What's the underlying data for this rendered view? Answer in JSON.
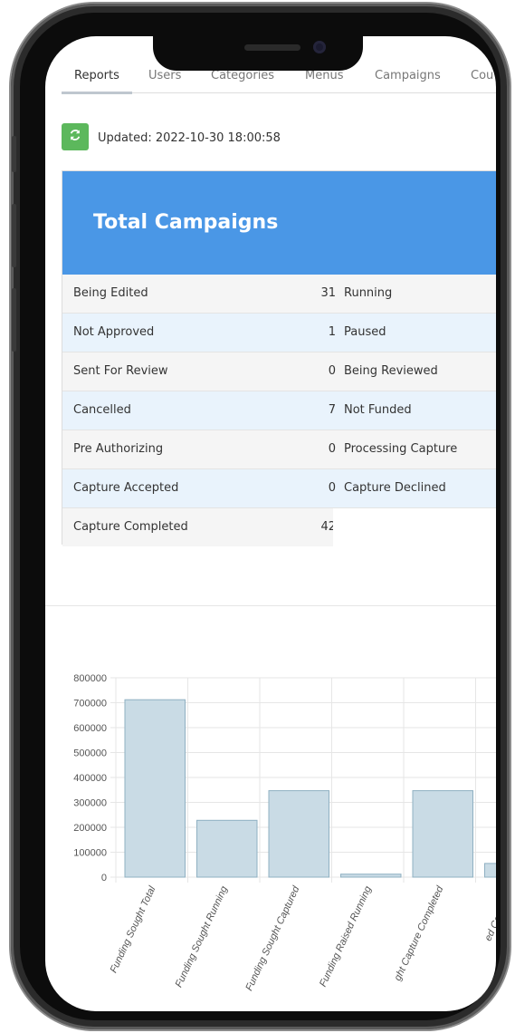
{
  "tabs": [
    "Reports",
    "Users",
    "Categories",
    "Menus",
    "Campaigns",
    "Cou"
  ],
  "updated": "Updated: 2022-10-30 18:00:58",
  "panel_title": "Total Campaigns",
  "rows": [
    {
      "l": "Being Edited",
      "v": "31",
      "r": "Running"
    },
    {
      "l": "Not Approved",
      "v": "1",
      "r": "Paused"
    },
    {
      "l": "Sent For Review",
      "v": "0",
      "r": "Being Reviewed"
    },
    {
      "l": "Cancelled",
      "v": "7",
      "r": "Not Funded"
    },
    {
      "l": "Pre Authorizing",
      "v": "0",
      "r": "Processing Capture"
    },
    {
      "l": "Capture Accepted",
      "v": "0",
      "r": "Capture Declined"
    },
    {
      "l": "Capture Completed",
      "v": "42",
      "r": ""
    }
  ],
  "colors": {
    "accent": "#4a97e6",
    "refresh": "#5cb85c",
    "bar_fill": "#c9dbe5",
    "bar_stroke": "#8fb0c2"
  },
  "icons": {
    "refresh": "refresh-icon"
  },
  "chart_data": {
    "type": "bar",
    "categories": [
      "Funding Sought Total",
      "Funding Sought Running",
      "Funding Sought Captured",
      "Funding Raised Running",
      "ght Capture Completed",
      "ed Capture C"
    ],
    "values": [
      712000,
      228000,
      347000,
      12000,
      347000,
      55000
    ],
    "ylim": [
      0,
      800000
    ],
    "yticks": [
      "800000",
      "700000",
      "600000",
      "500000",
      "400000",
      "300000",
      "200000",
      "100000",
      "0"
    ],
    "grid": true
  }
}
